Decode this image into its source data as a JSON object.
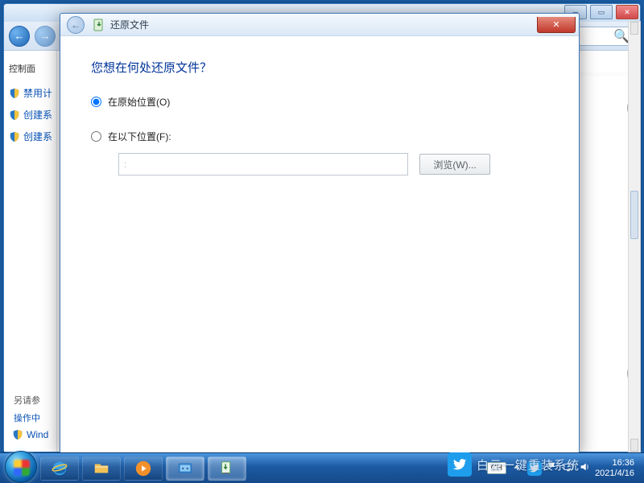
{
  "explorer": {
    "sidebar_header": "控制面",
    "links": [
      "禁用计",
      "创建系",
      "创建系"
    ],
    "footer_label": "另请参",
    "footer_link1": "操作中",
    "footer_link2": "Wind"
  },
  "dialog": {
    "title": "还原文件",
    "heading": "您想在何处还原文件？",
    "radio_original": "在原始位置(O)",
    "radio_following": "在以下位置(F):",
    "path_placeholder": ":",
    "browse_label": "浏览(W)..."
  },
  "taskbar": {
    "lang": "CH",
    "time": "16:36",
    "date": "2021/4/16"
  },
  "watermark": {
    "text": "白云一键重装系统"
  },
  "icons": {
    "back": "←",
    "forward": "→",
    "close": "✕",
    "search": "🔍"
  }
}
